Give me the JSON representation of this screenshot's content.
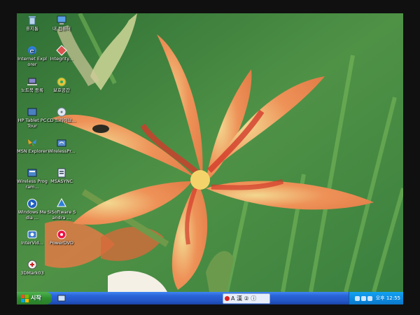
{
  "desktop": {
    "icons": [
      {
        "label": "휴지통",
        "icon": "recycle-bin-icon"
      },
      {
        "label": "내 컴퓨터",
        "icon": "my-computer-icon"
      },
      {
        "label": "Internet Explorer",
        "icon": "internet-explorer-icon"
      },
      {
        "label": "Integrity...",
        "icon": "integrity-icon"
      },
      {
        "label": "노트북 등록",
        "icon": "laptop-register-icon"
      },
      {
        "label": "보호공간",
        "icon": "protection-icon"
      },
      {
        "label": "HP Tablet PC Tour",
        "icon": "hp-tablet-icon"
      },
      {
        "label": "CD 드라이브...",
        "icon": "cd-drive-icon"
      },
      {
        "label": "MSN Explorer",
        "icon": "msn-butterfly-icon"
      },
      {
        "label": "WirelessPr...",
        "icon": "wireless-icon"
      },
      {
        "label": "Wireless Program...",
        "icon": "wireless-program-icon"
      },
      {
        "label": "MSASYNC",
        "icon": "msasync-icon"
      },
      {
        "label": "Windows Media ...",
        "icon": "windows-media-icon"
      },
      {
        "label": "SiSoftware Sandra ...",
        "icon": "sisoftware-sandra-icon"
      },
      {
        "label": "InterVid...",
        "icon": "intervideo-icon"
      },
      {
        "label": "PowerDVD",
        "icon": "powerdvd-icon"
      },
      {
        "label": "3DMark03",
        "icon": "3dmark-icon"
      }
    ]
  },
  "taskbar": {
    "start_label": "시작",
    "lang_label": "A 漢 ② ⓘ",
    "clock": "오후 12:55"
  }
}
